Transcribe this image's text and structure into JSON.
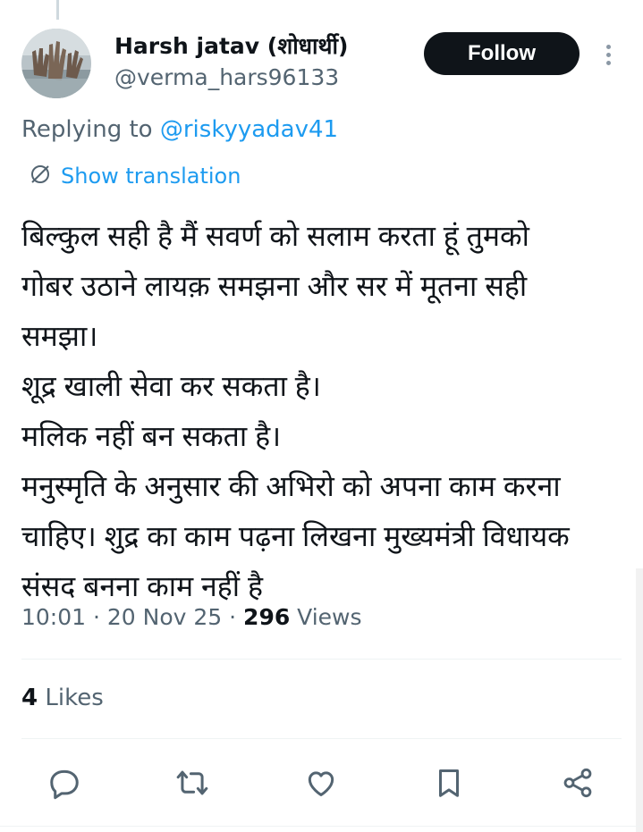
{
  "user": {
    "display_name": "Harsh jatav (शोधार्थी)",
    "handle": "@verma_hars96133"
  },
  "follow_label": "Follow",
  "reply": {
    "prefix": "Replying to ",
    "mention": "@riskyyadav41"
  },
  "translation_label": "Show translation",
  "tweet_lines": [
    "बिल्कुल सही है  मैं सवर्ण को सलाम करता हूं तुमको",
    "गोबर उठाने लायक़ समझना और सर में मूतना सही",
    "समझा।",
    "शूद्र खाली सेवा कर सकता है।",
    "मलिक नहीं  बन सकता है।",
    "मनुस्मृति के अनुसार की अभिरो को अपना काम करना",
    "चाहिए। शुद्र का काम पढ़ना लिखना मुख्यमंत्री विधायक",
    "संसद बनना काम नहीं है"
  ],
  "meta": {
    "time": "10:01",
    "separator": " · ",
    "date": "20 Nov 25",
    "views_count": "296",
    "views_label": " Views"
  },
  "likes": {
    "count": "4",
    "label": " Likes"
  },
  "icons": {
    "reply": "reply-icon",
    "retweet": "retweet-icon",
    "like": "heart-icon",
    "bookmark": "bookmark-icon",
    "share": "share-icon",
    "translate": "translate-icon",
    "more": "more-icon"
  },
  "colors": {
    "text": "#0f1419",
    "secondary": "#536471",
    "link": "#1d9bf0",
    "button": "#0f1419",
    "icon": "#536471"
  }
}
